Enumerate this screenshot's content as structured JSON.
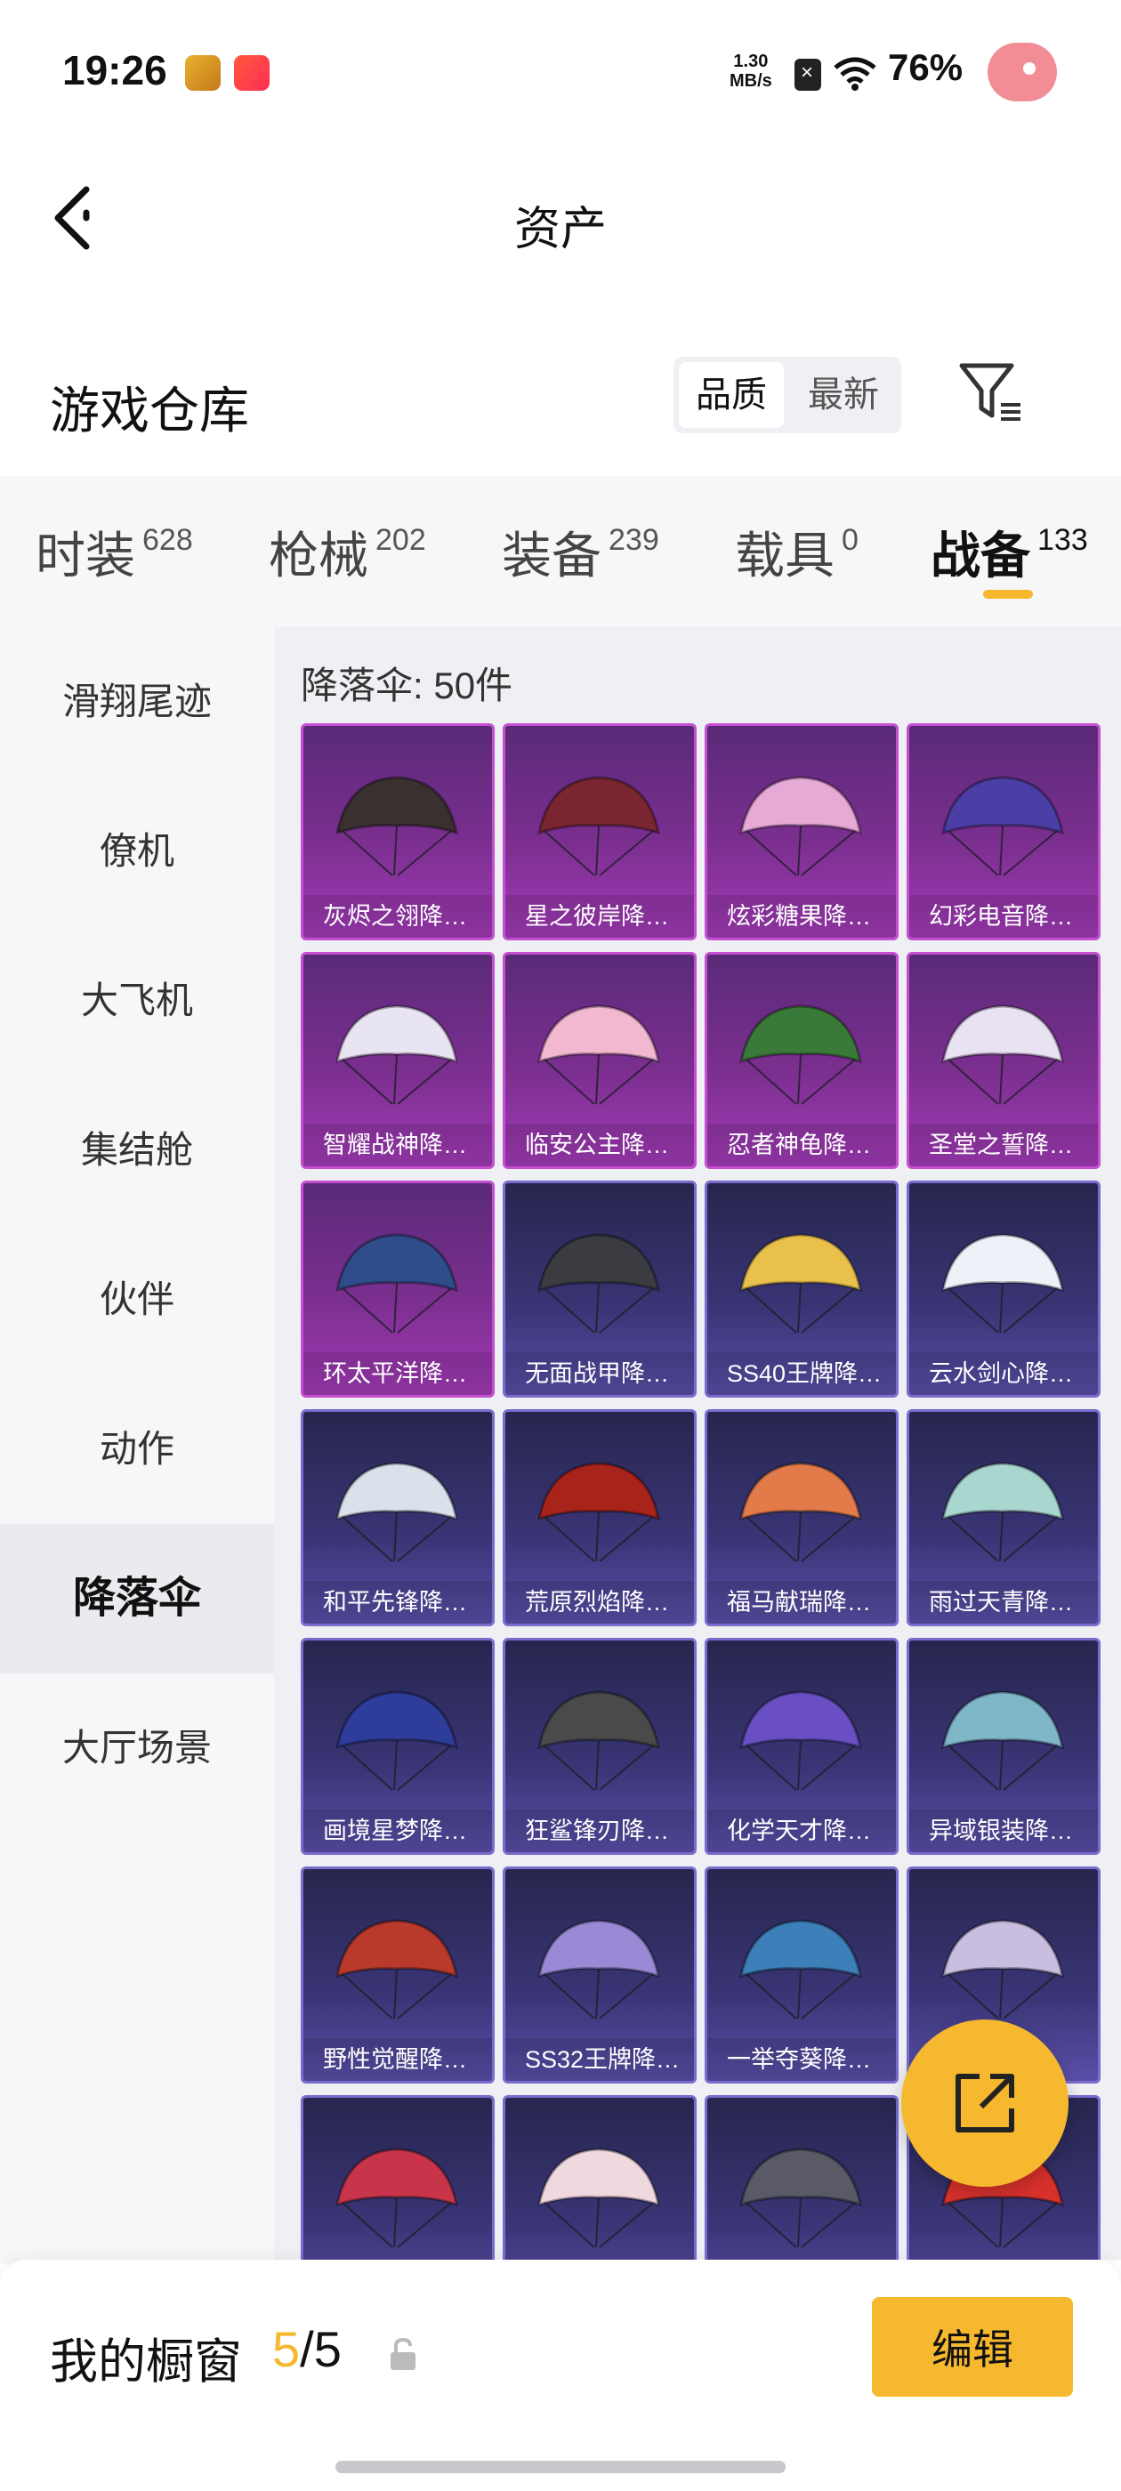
{
  "status_bar": {
    "time": "19:26",
    "net_speed_value": "1.30",
    "net_speed_unit": "MB/s",
    "battery": "76%"
  },
  "header": {
    "title": "资产"
  },
  "section": {
    "title": "游戏仓库",
    "sort_quality": "品质",
    "sort_latest": "最新"
  },
  "tabs": [
    {
      "label": "时装",
      "count": "628"
    },
    {
      "label": "枪械",
      "count": "202"
    },
    {
      "label": "装备",
      "count": "239"
    },
    {
      "label": "载具",
      "count": "0"
    },
    {
      "label": "战备",
      "count": "133"
    }
  ],
  "sidebar": {
    "items": [
      "滑翔尾迹",
      "僚机",
      "大飞机",
      "集结舱",
      "伙伴",
      "动作",
      "降落伞",
      "大厅场景"
    ],
    "active": "降落伞"
  },
  "content": {
    "count_label": "降落伞: 50件",
    "items": [
      {
        "name": "灰烬之翎降…",
        "tier": "purple",
        "color": "#3a3030"
      },
      {
        "name": "星之彼岸降…",
        "tier": "purple",
        "color": "#7a2630"
      },
      {
        "name": "炫彩糖果降…",
        "tier": "purple",
        "color": "#e7a9d6"
      },
      {
        "name": "幻彩电音降…",
        "tier": "purple",
        "color": "#4b3fa6"
      },
      {
        "name": "智耀战神降…",
        "tier": "purple",
        "color": "#e9e4f1"
      },
      {
        "name": "临安公主降…",
        "tier": "purple",
        "color": "#f1b8cf"
      },
      {
        "name": "忍者神龟降…",
        "tier": "purple",
        "color": "#3a7a38"
      },
      {
        "name": "圣堂之誓降…",
        "tier": "purple",
        "color": "#e8e2f2"
      },
      {
        "name": "环太平洋降…",
        "tier": "purple",
        "color": "#2f4d8a"
      },
      {
        "name": "无面战甲降…",
        "tier": "blue",
        "color": "#3b3b42"
      },
      {
        "name": "SS40王牌降…",
        "tier": "blue",
        "color": "#e8c04a"
      },
      {
        "name": "云水剑心降…",
        "tier": "blue",
        "color": "#eef2f8"
      },
      {
        "name": "和平先锋降…",
        "tier": "blue",
        "color": "#d9e2ea"
      },
      {
        "name": "荒原烈焰降…",
        "tier": "blue",
        "color": "#a8231a"
      },
      {
        "name": "福马献瑞降…",
        "tier": "blue",
        "color": "#e27a4a"
      },
      {
        "name": "雨过天青降…",
        "tier": "blue",
        "color": "#a9d6cf"
      },
      {
        "name": "画境星梦降…",
        "tier": "blue",
        "color": "#2e3d9a"
      },
      {
        "name": "狂鲨锋刃降…",
        "tier": "blue",
        "color": "#4a4a4a"
      },
      {
        "name": "化学天才降…",
        "tier": "blue",
        "color": "#6a4fc4"
      },
      {
        "name": "异域银装降…",
        "tier": "blue",
        "color": "#7fb6c8"
      },
      {
        "name": "野性觉醒降…",
        "tier": "blue",
        "color": "#b9392a"
      },
      {
        "name": "SS32王牌降…",
        "tier": "blue",
        "color": "#9a8ad6"
      },
      {
        "name": "一举夺葵降…",
        "tier": "blue",
        "color": "#3d7fb8"
      },
      {
        "name": "",
        "tier": "blue",
        "color": "#c9bedf"
      },
      {
        "name": "",
        "tier": "blue",
        "color": "#c8354a"
      },
      {
        "name": "",
        "tier": "blue",
        "color": "#f0d8df"
      },
      {
        "name": "",
        "tier": "blue",
        "color": "#5a5a66"
      },
      {
        "name": "",
        "tier": "blue",
        "color": "#d8312c"
      }
    ]
  },
  "bottom_bar": {
    "showcase_label": "我的橱窗",
    "showcase_current": "5",
    "showcase_total": "/5",
    "edit_label": "编辑"
  },
  "colors": {
    "accent": "#f5b82e",
    "purple_tier": "#a23ab7",
    "blue_tier": "#5a4fa8"
  }
}
